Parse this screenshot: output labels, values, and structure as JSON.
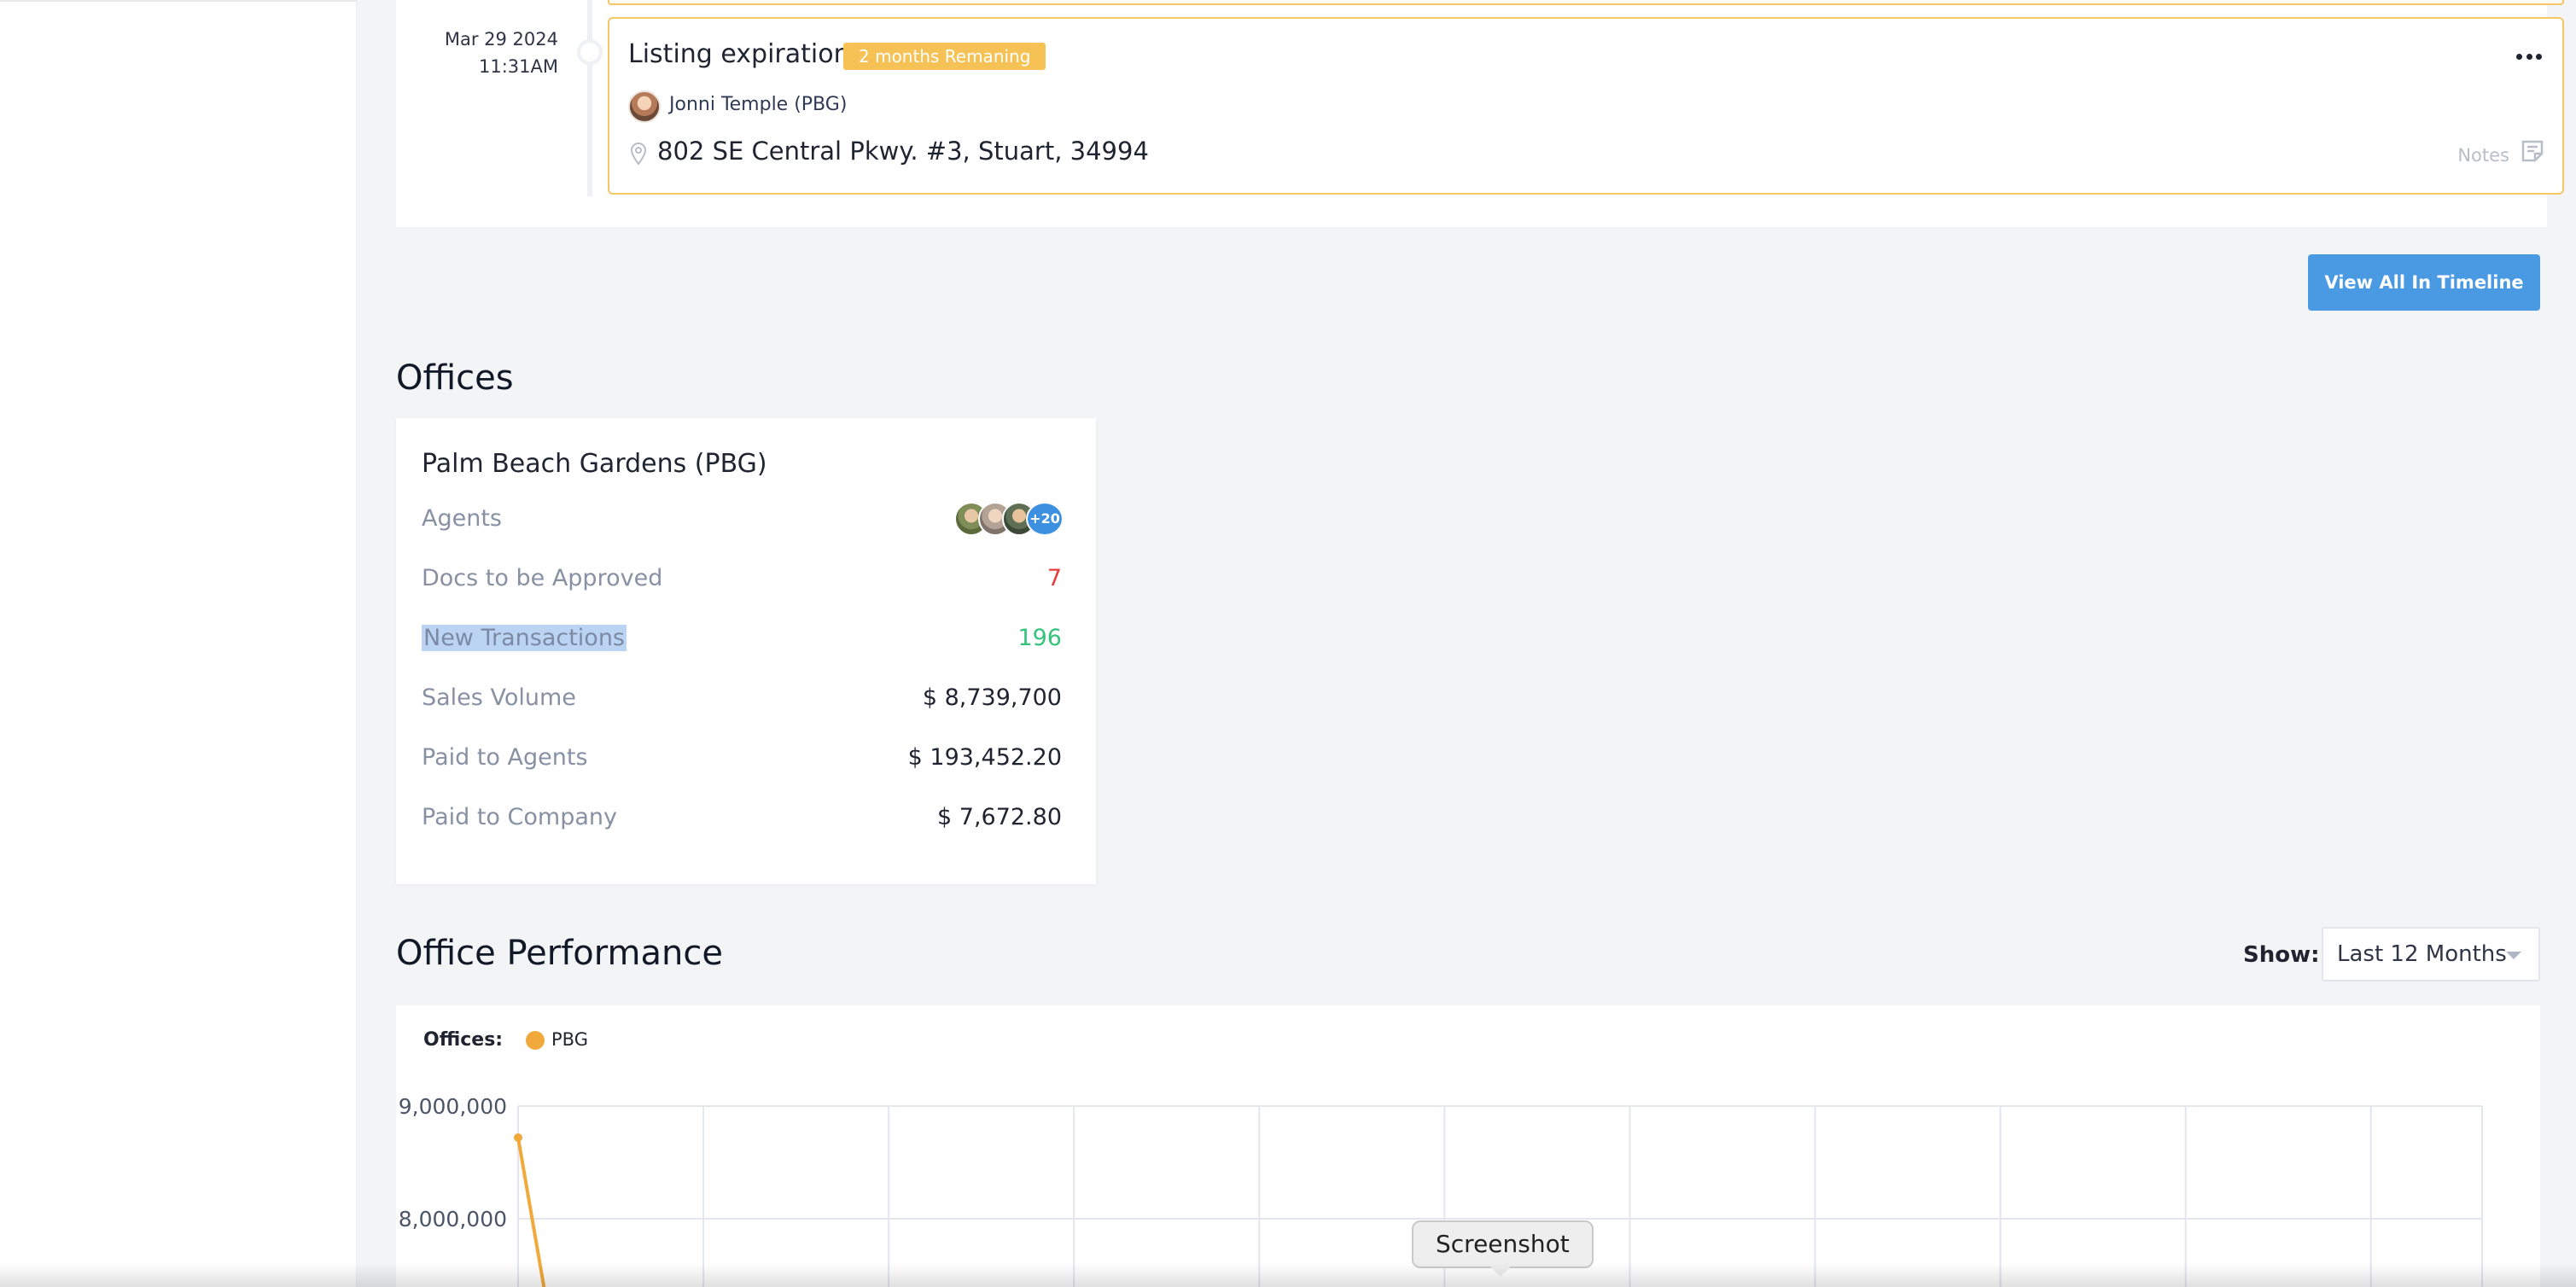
{
  "timeline": {
    "event": {
      "date": "Mar 29 2024",
      "time": "11:31AM",
      "title": "Listing expiration",
      "badge": "2 months Remaning",
      "agent": "Jonni Temple (PBG)",
      "address": "802 SE Central Pkwy. #3, Stuart, 34994",
      "notes_label": "Notes"
    },
    "view_all_label": "View All In Timeline"
  },
  "offices": {
    "heading": "Offices",
    "card": {
      "name": "Palm Beach Gardens (PBG)",
      "agents_label": "Agents",
      "agents_more": "+20",
      "rows": [
        {
          "label": "Docs to be Approved",
          "value": "7"
        },
        {
          "label": "New Transactions",
          "value": "196"
        },
        {
          "label": "Sales Volume",
          "value": "$ 8,739,700"
        },
        {
          "label": "Paid to Agents",
          "value": "$ 193,452.20"
        },
        {
          "label": "Paid to Company",
          "value": "$ 7,672.80"
        }
      ]
    }
  },
  "performance": {
    "heading": "Office Performance",
    "show_label": "Show:",
    "range_selected": "Last 12 Months",
    "legend_title": "Offices:",
    "legend_item": "PBG",
    "colors": {
      "series": "#f2a93b",
      "accent": "#4a9ae3"
    }
  },
  "chart_data": {
    "type": "line",
    "series": [
      {
        "name": "PBG",
        "values": [
          8720000
        ]
      }
    ],
    "y_ticks": [
      "9,000,000",
      "8,000,000"
    ],
    "ylim": [
      7500000,
      9000000
    ],
    "grid": true,
    "legend": "top-left"
  },
  "overlay": {
    "tooltip": "Screenshot"
  }
}
